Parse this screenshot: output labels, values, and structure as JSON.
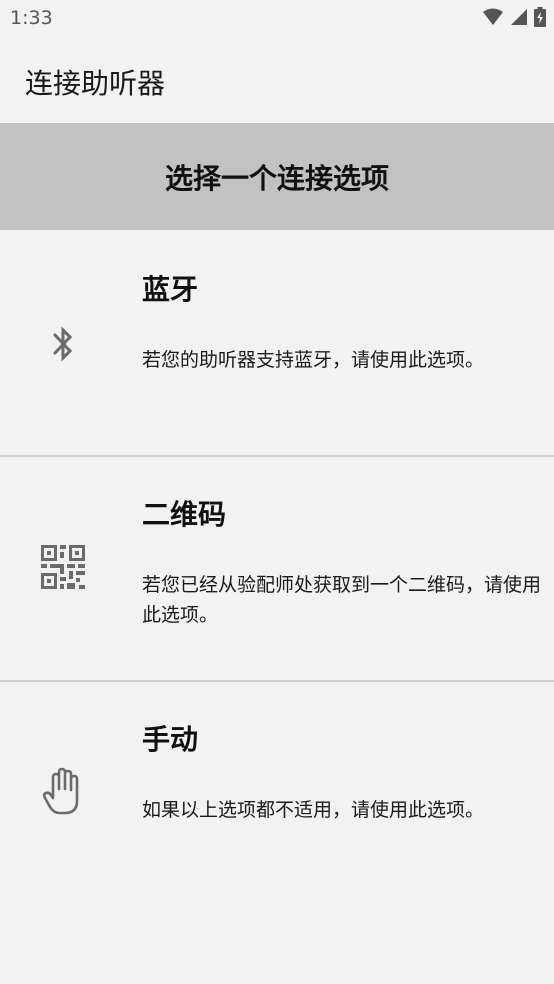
{
  "status_bar": {
    "time": "1:33",
    "icons": [
      "wifi-icon",
      "signal-icon",
      "battery-charging-icon"
    ]
  },
  "app_bar": {
    "title": "连接助听器"
  },
  "prompt": {
    "text": "选择一个连接选项"
  },
  "options": [
    {
      "icon": "bluetooth-icon",
      "title": "蓝牙",
      "description": "若您的助听器支持蓝牙，请使用此选项。"
    },
    {
      "icon": "qr-code-icon",
      "title": "二维码",
      "description": "若您已经从验配师处获取到一个二维码，请使用此选项。"
    },
    {
      "icon": "hand-icon",
      "title": "手动",
      "description": "如果以上选项都不适用，请使用此选项。"
    }
  ],
  "colors": {
    "background": "#f2f2f2",
    "banner": "#c2c2c2",
    "icon": "#6b6b6b",
    "divider": "#cfcfcf"
  }
}
